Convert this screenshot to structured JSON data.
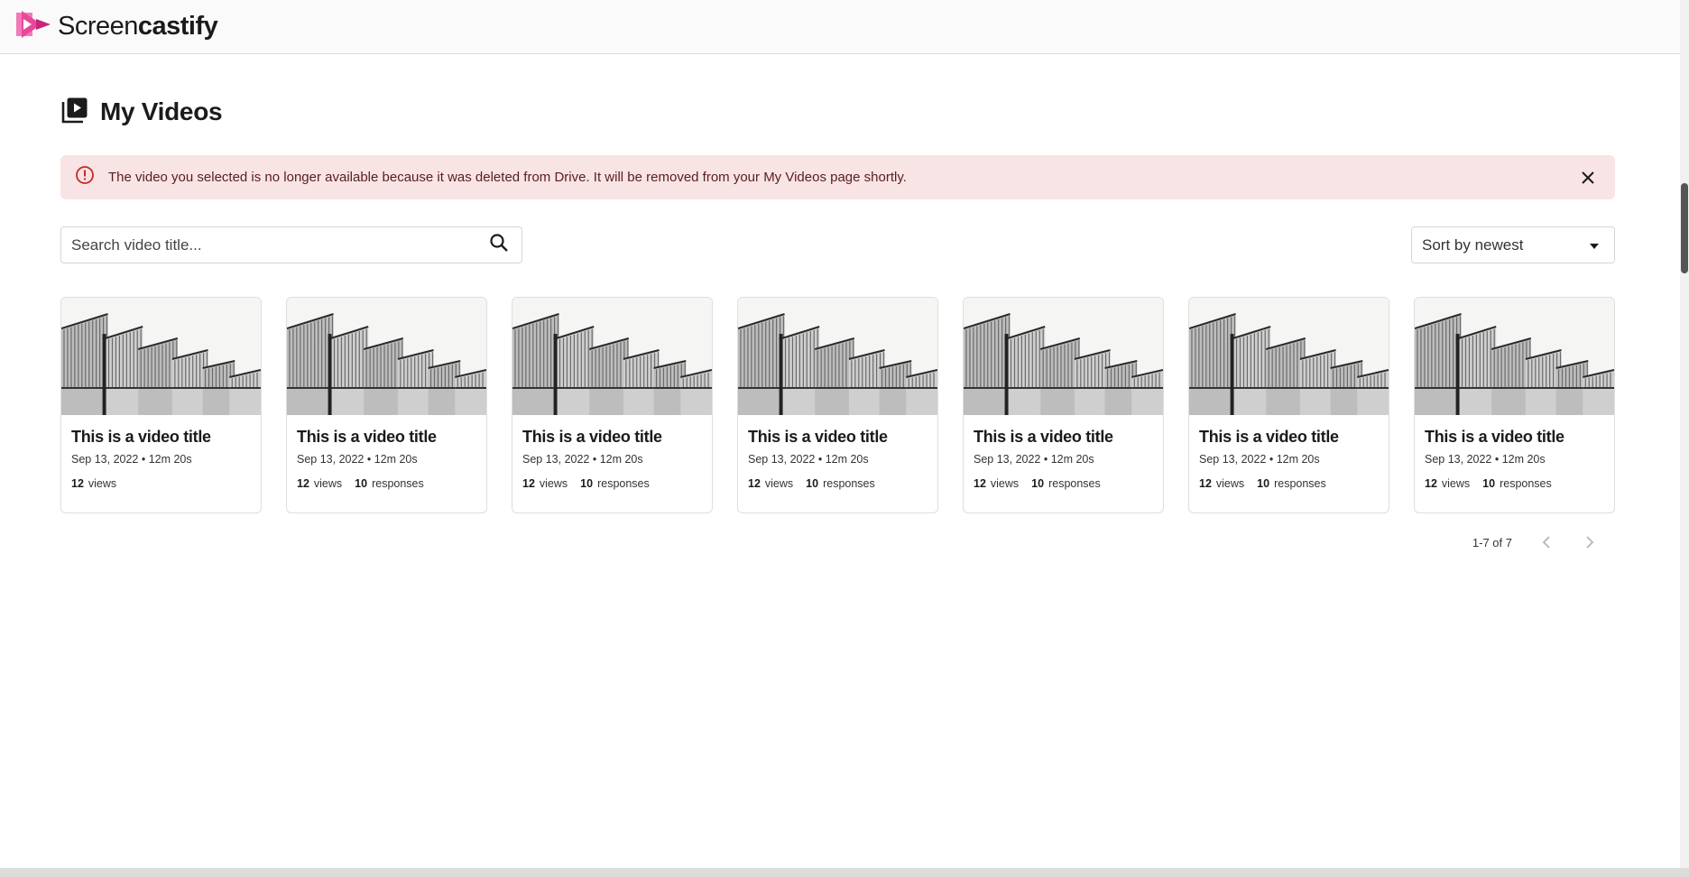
{
  "header": {
    "logo_text_light": "Screen",
    "logo_text_bold": "castify",
    "logo_icon": "screencastify-camera-icon",
    "brand_color": "#e8489b"
  },
  "page": {
    "title": "My Videos",
    "title_icon": "video-library-icon"
  },
  "alert": {
    "icon": "error-circle-icon",
    "message": "The video you selected is no longer available because it was deleted from Drive. It will be removed from your My Videos page shortly.",
    "close_icon": "close-icon",
    "background": "#f8e4e4",
    "color": "#c62828"
  },
  "search": {
    "placeholder": "Search video title...",
    "value": "",
    "icon": "search-icon"
  },
  "sort": {
    "selected": "Sort by newest",
    "icon": "caret-down-icon"
  },
  "videos": [
    {
      "title": "This is a video title",
      "meta": "Sep 13, 2022 • 12m 20s",
      "views": "12",
      "views_label": "views",
      "responses": "",
      "responses_label": ""
    },
    {
      "title": "This is a video title",
      "meta": "Sep 13, 2022 • 12m 20s",
      "views": "12",
      "views_label": "views",
      "responses": "10",
      "responses_label": "responses"
    },
    {
      "title": "This is a video title",
      "meta": "Sep 13, 2022 • 12m 20s",
      "views": "12",
      "views_label": "views",
      "responses": "10",
      "responses_label": "responses"
    },
    {
      "title": "This is a video title",
      "meta": "Sep 13, 2022 • 12m 20s",
      "views": "12",
      "views_label": "views",
      "responses": "10",
      "responses_label": "responses"
    },
    {
      "title": "This is a video title",
      "meta": "Sep 13, 2022 • 12m 20s",
      "views": "12",
      "views_label": "views",
      "responses": "10",
      "responses_label": "responses"
    },
    {
      "title": "This is a video title",
      "meta": "Sep 13, 2022 • 12m 20s",
      "views": "12",
      "views_label": "views",
      "responses": "10",
      "responses_label": "responses"
    },
    {
      "title": "This is a video title",
      "meta": "Sep 13, 2022 • 12m 20s",
      "views": "12",
      "views_label": "views",
      "responses": "10",
      "responses_label": "responses"
    }
  ],
  "pagination": {
    "range": "1-7 of 7",
    "prev_icon": "chevron-left-icon",
    "next_icon": "chevron-right-icon"
  }
}
